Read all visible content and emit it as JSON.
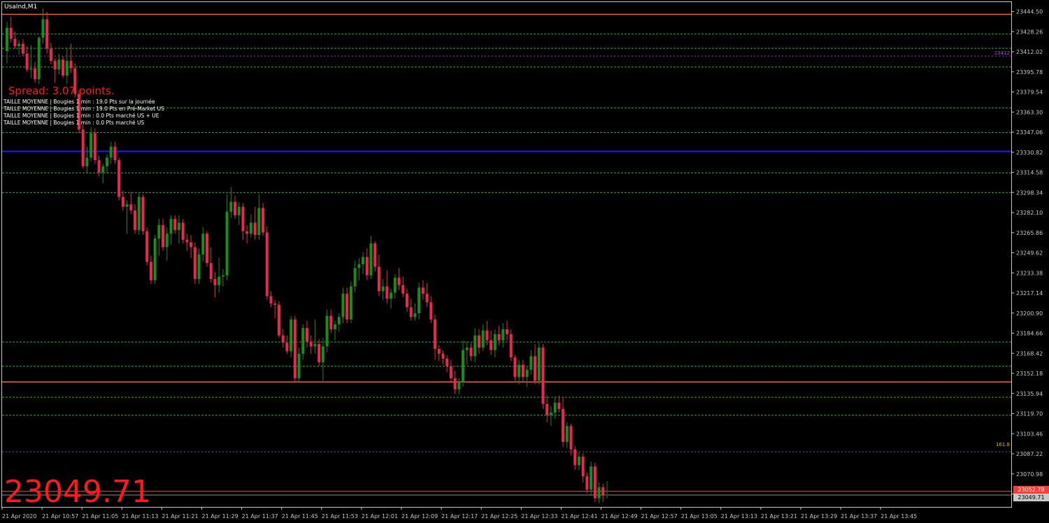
{
  "window": {
    "title": "UsaInd,M1"
  },
  "overlay": {
    "spread_text": "Spread: 3.07 points.",
    "avg_lines": [
      "TAILLE MOYENNE | Bougies 1 min : 19.0 Pts sur la journée",
      "TAILLE MOYENNE | Bougies 1 min : 19.0 Pts en Pré-Market US",
      "TAILLE MOYENNE | Bougies 1 min : 0.0 Pts marché US + UE",
      "TAILLE MOYENNE | Bougies 1 min : 0.0 Pts marché US"
    ],
    "big_price": "23049.71",
    "marker_labels": [
      "23412",
      "161.8"
    ]
  },
  "colors": {
    "background": "#000000",
    "bull": "#1a8c1a",
    "bear": "#e8294f",
    "grid_dashed": "#2fae2f",
    "level_orange": "#ff5a36",
    "level_blue": "#1c1cff",
    "big_price": "#ff1a1a",
    "axis": "#c8c8c8",
    "bid_line": "#8c8c8c",
    "ask_line": "#ff3b3b"
  },
  "chart_data": {
    "type": "candlestick",
    "symbol": "UsaInd",
    "timeframe": "M1",
    "y_range": [
      23040.0,
      23452.0
    ],
    "y_ticks": [
      "23444.50",
      "23428.26",
      "23412.02",
      "23395.78",
      "23379.54",
      "23363.30",
      "23347.06",
      "23330.82",
      "23314.58",
      "23298.34",
      "23282.10",
      "23265.86",
      "23249.62",
      "23233.38",
      "23217.14",
      "23200.90",
      "23184.66",
      "23168.42",
      "23152.18",
      "23135.94",
      "23119.70",
      "23103.46",
      "23087.22",
      "23070.98",
      "23054.74"
    ],
    "x_labels": [
      "21 Apr 2020",
      "21 Apr 10:57",
      "21 Apr 11:05",
      "21 Apr 11:13",
      "21 Apr 11:21",
      "21 Apr 11:29",
      "21 Apr 11:37",
      "21 Apr 11:45",
      "21 Apr 11:53",
      "21 Apr 12:01",
      "21 Apr 12:09",
      "21 Apr 12:17",
      "21 Apr 12:25",
      "21 Apr 12:33",
      "21 Apr 12:41",
      "21 Apr 12:49",
      "21 Apr 12:57",
      "21 Apr 13:05",
      "21 Apr 13:13",
      "21 Apr 13:21",
      "21 Apr 13:29",
      "21 Apr 13:37",
      "21 Apr 13:45"
    ],
    "solid_levels": [
      {
        "price": 23442.0,
        "color": "orange"
      },
      {
        "price": 23330.2,
        "color": "blue"
      },
      {
        "price": 23142.0,
        "color": "orange"
      }
    ],
    "dashed_levels": [
      23426.0,
      23414.3,
      23399.0,
      23365.7,
      23345.5,
      23312.6,
      23296.4,
      23174.6,
      23154.8,
      23129.5,
      23114.8
    ],
    "dotted_levels": [
      23408.0,
      23085.0
    ],
    "bid_price": 23049.71,
    "ask_price": 23052.78,
    "candles": [
      [
        23412,
        23436,
        23402,
        23431
      ],
      [
        23431,
        23440,
        23419,
        23422
      ],
      [
        23422,
        23428,
        23414,
        23416
      ],
      [
        23416,
        23421,
        23409,
        23418
      ],
      [
        23418,
        23422,
        23408,
        23410
      ],
      [
        23410,
        23416,
        23395,
        23397
      ],
      [
        23397,
        23417,
        23390,
        23398
      ],
      [
        23398,
        23403,
        23386,
        23389
      ],
      [
        23389,
        23424,
        23385,
        23423
      ],
      [
        23423,
        23447,
        23418,
        23438
      ],
      [
        23438,
        23444,
        23410,
        23414
      ],
      [
        23414,
        23419,
        23401,
        23404
      ],
      [
        23404,
        23406,
        23386,
        23397
      ],
      [
        23397,
        23410,
        23393,
        23405
      ],
      [
        23405,
        23408,
        23390,
        23392
      ],
      [
        23392,
        23414,
        23385,
        23404
      ],
      [
        23404,
        23418,
        23394,
        23398
      ],
      [
        23398,
        23402,
        23374,
        23377
      ],
      [
        23377,
        23380,
        23345,
        23348
      ],
      [
        23348,
        23352,
        23316,
        23318
      ],
      [
        23318,
        23334,
        23312,
        23325
      ],
      [
        23325,
        23350,
        23322,
        23345
      ],
      [
        23345,
        23349,
        23320,
        23323
      ],
      [
        23323,
        23327,
        23310,
        23313
      ],
      [
        23313,
        23320,
        23304,
        23318
      ],
      [
        23318,
        23328,
        23312,
        23325
      ],
      [
        23325,
        23338,
        23320,
        23334
      ],
      [
        23334,
        23338,
        23320,
        23323
      ],
      [
        23323,
        23325,
        23290,
        23293
      ],
      [
        23293,
        23298,
        23282,
        23285
      ],
      [
        23285,
        23290,
        23263,
        23287
      ],
      [
        23287,
        23297,
        23279,
        23282
      ],
      [
        23282,
        23287,
        23263,
        23266
      ],
      [
        23266,
        23296,
        23262,
        23293
      ],
      [
        23293,
        23295,
        23262,
        23265
      ],
      [
        23265,
        23268,
        23237,
        23240
      ],
      [
        23240,
        23245,
        23222,
        23225
      ],
      [
        23225,
        23262,
        23222,
        23259
      ],
      [
        23259,
        23275,
        23245,
        23270
      ],
      [
        23270,
        23275,
        23249,
        23252
      ],
      [
        23252,
        23268,
        23241,
        23263
      ],
      [
        23263,
        23278,
        23254,
        23275
      ],
      [
        23275,
        23278,
        23263,
        23266
      ],
      [
        23266,
        23278,
        23255,
        23272
      ],
      [
        23272,
        23275,
        23255,
        23258
      ],
      [
        23258,
        23263,
        23249,
        23256
      ],
      [
        23256,
        23262,
        23243,
        23252
      ],
      [
        23252,
        23256,
        23222,
        23226
      ],
      [
        23226,
        23251,
        23222,
        23246
      ],
      [
        23246,
        23268,
        23240,
        23263
      ],
      [
        23263,
        23265,
        23236,
        23239
      ],
      [
        23239,
        23252,
        23223,
        23226
      ],
      [
        23226,
        23232,
        23211,
        23221
      ],
      [
        23221,
        23243,
        23215,
        23228
      ],
      [
        23228,
        23234,
        23220,
        23229
      ],
      [
        23229,
        23295,
        23225,
        23281
      ],
      [
        23281,
        23301,
        23276,
        23289
      ],
      [
        23289,
        23294,
        23275,
        23278
      ],
      [
        23278,
        23289,
        23270,
        23285
      ],
      [
        23285,
        23288,
        23258,
        23265
      ],
      [
        23265,
        23270,
        23255,
        23263
      ],
      [
        23263,
        23279,
        23260,
        23272
      ],
      [
        23272,
        23285,
        23258,
        23262
      ],
      [
        23262,
        23295,
        23258,
        23284
      ],
      [
        23284,
        23288,
        23261,
        23264
      ],
      [
        23264,
        23269,
        23209,
        23212
      ],
      [
        23212,
        23216,
        23203,
        23206
      ],
      [
        23206,
        23209,
        23194,
        23205
      ],
      [
        23205,
        23208,
        23178,
        23180
      ],
      [
        23180,
        23185,
        23170,
        23174
      ],
      [
        23174,
        23180,
        23165,
        23167
      ],
      [
        23167,
        23196,
        23162,
        23193
      ],
      [
        23193,
        23196,
        23142,
        23145
      ],
      [
        23145,
        23170,
        23142,
        23165
      ],
      [
        23165,
        23189,
        23160,
        23186
      ],
      [
        23186,
        23192,
        23170,
        23175
      ],
      [
        23175,
        23180,
        23165,
        23171
      ],
      [
        23171,
        23193,
        23165,
        23173
      ],
      [
        23173,
        23177,
        23155,
        23158
      ],
      [
        23158,
        23178,
        23143,
        23171
      ],
      [
        23171,
        23201,
        23166,
        23196
      ],
      [
        23196,
        23201,
        23182,
        23185
      ],
      [
        23185,
        23192,
        23176,
        23189
      ],
      [
        23189,
        23198,
        23183,
        23195
      ],
      [
        23195,
        23219,
        23190,
        23214
      ],
      [
        23214,
        23219,
        23190,
        23193
      ],
      [
        23193,
        23224,
        23190,
        23220
      ],
      [
        23220,
        23241,
        23215,
        23235
      ],
      [
        23235,
        23243,
        23225,
        23238
      ],
      [
        23238,
        23248,
        23230,
        23244
      ],
      [
        23244,
        23251,
        23225,
        23229
      ],
      [
        23229,
        23261,
        23226,
        23255
      ],
      [
        23255,
        23257,
        23232,
        23236
      ],
      [
        23236,
        23246,
        23212,
        23216
      ],
      [
        23216,
        23226,
        23209,
        23220
      ],
      [
        23220,
        23233,
        23206,
        23210
      ],
      [
        23210,
        23218,
        23202,
        23215
      ],
      [
        23215,
        23230,
        23210,
        23227
      ],
      [
        23227,
        23235,
        23217,
        23221
      ],
      [
        23221,
        23228,
        23211,
        23214
      ],
      [
        23214,
        23218,
        23199,
        23203
      ],
      [
        23203,
        23210,
        23192,
        23195
      ],
      [
        23195,
        23206,
        23192,
        23198
      ],
      [
        23198,
        23223,
        23193,
        23219
      ],
      [
        23219,
        23225,
        23209,
        23214
      ],
      [
        23214,
        23223,
        23203,
        23207
      ],
      [
        23207,
        23212,
        23190,
        23193
      ],
      [
        23193,
        23197,
        23160,
        23169
      ],
      [
        23169,
        23172,
        23159,
        23165
      ],
      [
        23165,
        23168,
        23156,
        23161
      ],
      [
        23161,
        23164,
        23150,
        23155
      ],
      [
        23155,
        23160,
        23141,
        23145
      ],
      [
        23145,
        23151,
        23132,
        23136
      ],
      [
        23136,
        23145,
        23132,
        23142
      ],
      [
        23142,
        23176,
        23138,
        23168
      ],
      [
        23168,
        23175,
        23156,
        23170
      ],
      [
        23170,
        23174,
        23159,
        23163
      ],
      [
        23163,
        23186,
        23158,
        23180
      ],
      [
        23180,
        23185,
        23165,
        23170
      ],
      [
        23170,
        23189,
        23167,
        23184
      ],
      [
        23184,
        23192,
        23172,
        23176
      ],
      [
        23176,
        23184,
        23164,
        23168
      ],
      [
        23168,
        23185,
        23162,
        23181
      ],
      [
        23181,
        23188,
        23172,
        23176
      ],
      [
        23176,
        23190,
        23170,
        23185
      ],
      [
        23185,
        23192,
        23176,
        23181
      ],
      [
        23181,
        23185,
        23159,
        23162
      ],
      [
        23162,
        23164,
        23143,
        23146
      ],
      [
        23146,
        23160,
        23140,
        23156
      ],
      [
        23156,
        23160,
        23142,
        23146
      ],
      [
        23146,
        23155,
        23138,
        23152
      ],
      [
        23152,
        23168,
        23148,
        23163
      ],
      [
        23163,
        23173,
        23140,
        23143
      ],
      [
        23143,
        23174,
        23140,
        23170
      ],
      [
        23170,
        23173,
        23120,
        23124
      ],
      [
        23124,
        23131,
        23109,
        23115
      ],
      [
        23115,
        23122,
        23106,
        23117
      ],
      [
        23117,
        23130,
        23112,
        23125
      ],
      [
        23125,
        23131,
        23117,
        23120
      ],
      [
        23120,
        23130,
        23089,
        23093
      ],
      [
        23093,
        23109,
        23088,
        23106
      ],
      [
        23106,
        23108,
        23082,
        23087
      ],
      [
        23087,
        23090,
        23070,
        23074
      ],
      [
        23074,
        23085,
        23070,
        23081
      ],
      [
        23081,
        23084,
        23060,
        23065
      ],
      [
        23065,
        23068,
        23051,
        23054
      ],
      [
        23054,
        23077,
        23050,
        23073
      ],
      [
        23073,
        23076,
        23044,
        23047
      ],
      [
        23047,
        23060,
        23043,
        23056
      ],
      [
        23056,
        23059,
        23044,
        23050
      ],
      [
        23050,
        23061,
        23047,
        23050
      ]
    ]
  }
}
